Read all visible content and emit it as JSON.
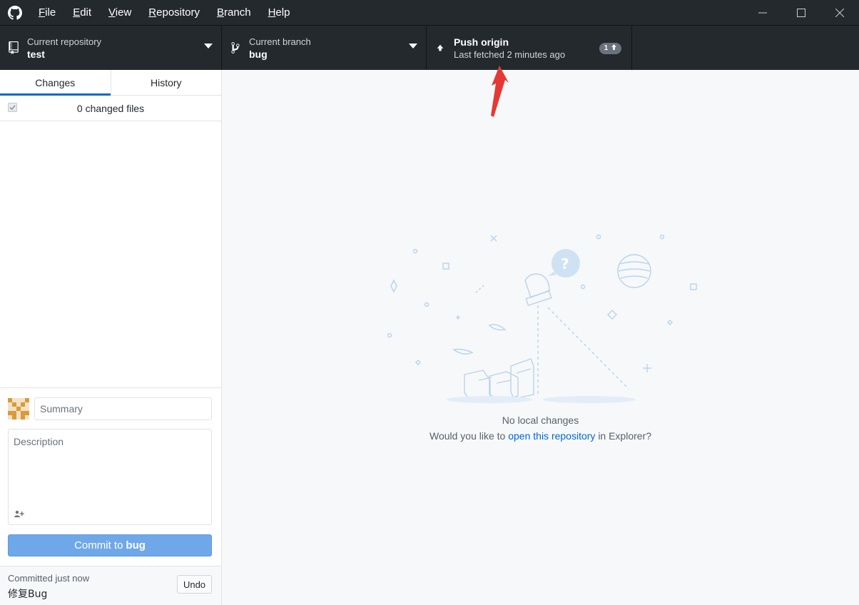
{
  "menu": {
    "items": [
      {
        "key": "F",
        "rest": "ile"
      },
      {
        "key": "E",
        "rest": "dit"
      },
      {
        "key": "V",
        "rest": "iew"
      },
      {
        "key": "R",
        "rest": "epository"
      },
      {
        "key": "B",
        "rest": "ranch"
      },
      {
        "key": "H",
        "rest": "elp"
      }
    ]
  },
  "toolbar": {
    "repo": {
      "description": "Current repository",
      "title": "test"
    },
    "branch": {
      "description": "Current branch",
      "title": "bug"
    },
    "push": {
      "title": "Push origin",
      "description": "Last fetched 2 minutes ago",
      "badge": "1"
    }
  },
  "sidebar": {
    "tabs": [
      {
        "label": "Changes"
      },
      {
        "label": "History"
      }
    ],
    "changed_files": "0 changed files",
    "commit": {
      "summary_placeholder": "Summary",
      "description_placeholder": "Description",
      "button_prefix": "Commit to",
      "button_branch": "bug"
    },
    "undo": {
      "meta": "Committed just now",
      "message": "修复Bug",
      "button": "Undo"
    }
  },
  "main": {
    "title": "No local changes",
    "sub_prefix": "Would you like to",
    "sub_link": "open this repository",
    "sub_suffix": "in Explorer?"
  },
  "colors": {
    "titlebar_bg": "#24292e",
    "accent": "#0366d6",
    "commit_button": "#6fa8e8",
    "annotation_arrow": "#e53935"
  },
  "icons": [
    "github-logo-icon",
    "repo-icon",
    "branch-icon",
    "arrow-up-icon",
    "caret-down-icon",
    "minimize-icon",
    "maximize-icon",
    "close-icon",
    "person-add-icon",
    "checkbox-icon"
  ]
}
